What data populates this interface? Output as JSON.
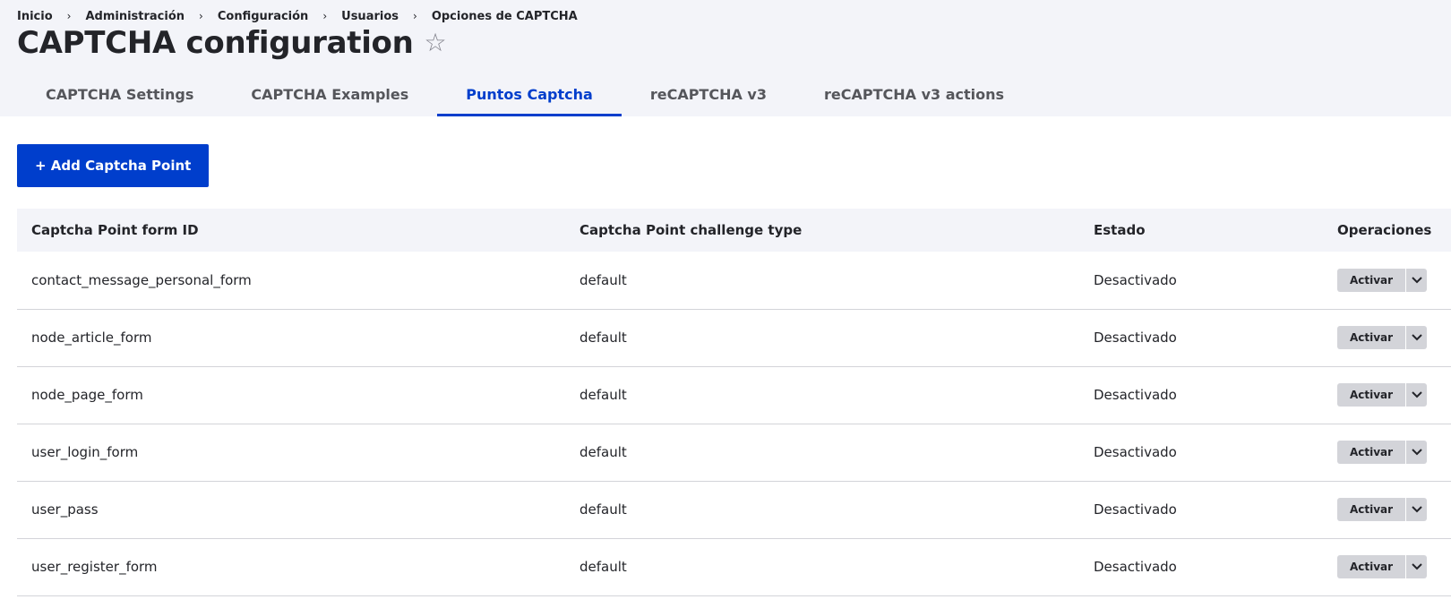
{
  "breadcrumb": [
    "Inicio",
    "Administración",
    "Configuración",
    "Usuarios",
    "Opciones de CAPTCHA"
  ],
  "breadcrumb_separator": "›",
  "page": {
    "title": "CAPTCHA configuration",
    "star_icon": "☆"
  },
  "tabs": [
    {
      "label": "CAPTCHA Settings",
      "active": false
    },
    {
      "label": "CAPTCHA Examples",
      "active": false
    },
    {
      "label": "Puntos Captcha",
      "active": true
    },
    {
      "label": "reCAPTCHA v3",
      "active": false
    },
    {
      "label": "reCAPTCHA v3 actions",
      "active": false
    }
  ],
  "add_button": {
    "label": "+ Add Captcha Point"
  },
  "table": {
    "headers": {
      "form_id": "Captcha Point form ID",
      "type": "Captcha Point challenge type",
      "state": "Estado",
      "operations": "Operaciones"
    },
    "rows": [
      {
        "form_id": "contact_message_personal_form",
        "type": "default",
        "state": "Desactivado",
        "action": "Activar"
      },
      {
        "form_id": "node_article_form",
        "type": "default",
        "state": "Desactivado",
        "action": "Activar"
      },
      {
        "form_id": "node_page_form",
        "type": "default",
        "state": "Desactivado",
        "action": "Activar"
      },
      {
        "form_id": "user_login_form",
        "type": "default",
        "state": "Desactivado",
        "action": "Activar"
      },
      {
        "form_id": "user_pass",
        "type": "default",
        "state": "Desactivado",
        "action": "Activar"
      },
      {
        "form_id": "user_register_form",
        "type": "default",
        "state": "Desactivado",
        "action": "Activar"
      }
    ]
  },
  "colors": {
    "accent": "#003ecc",
    "header_bg": "#f3f4f9",
    "button_grey": "#d3d4d9"
  }
}
